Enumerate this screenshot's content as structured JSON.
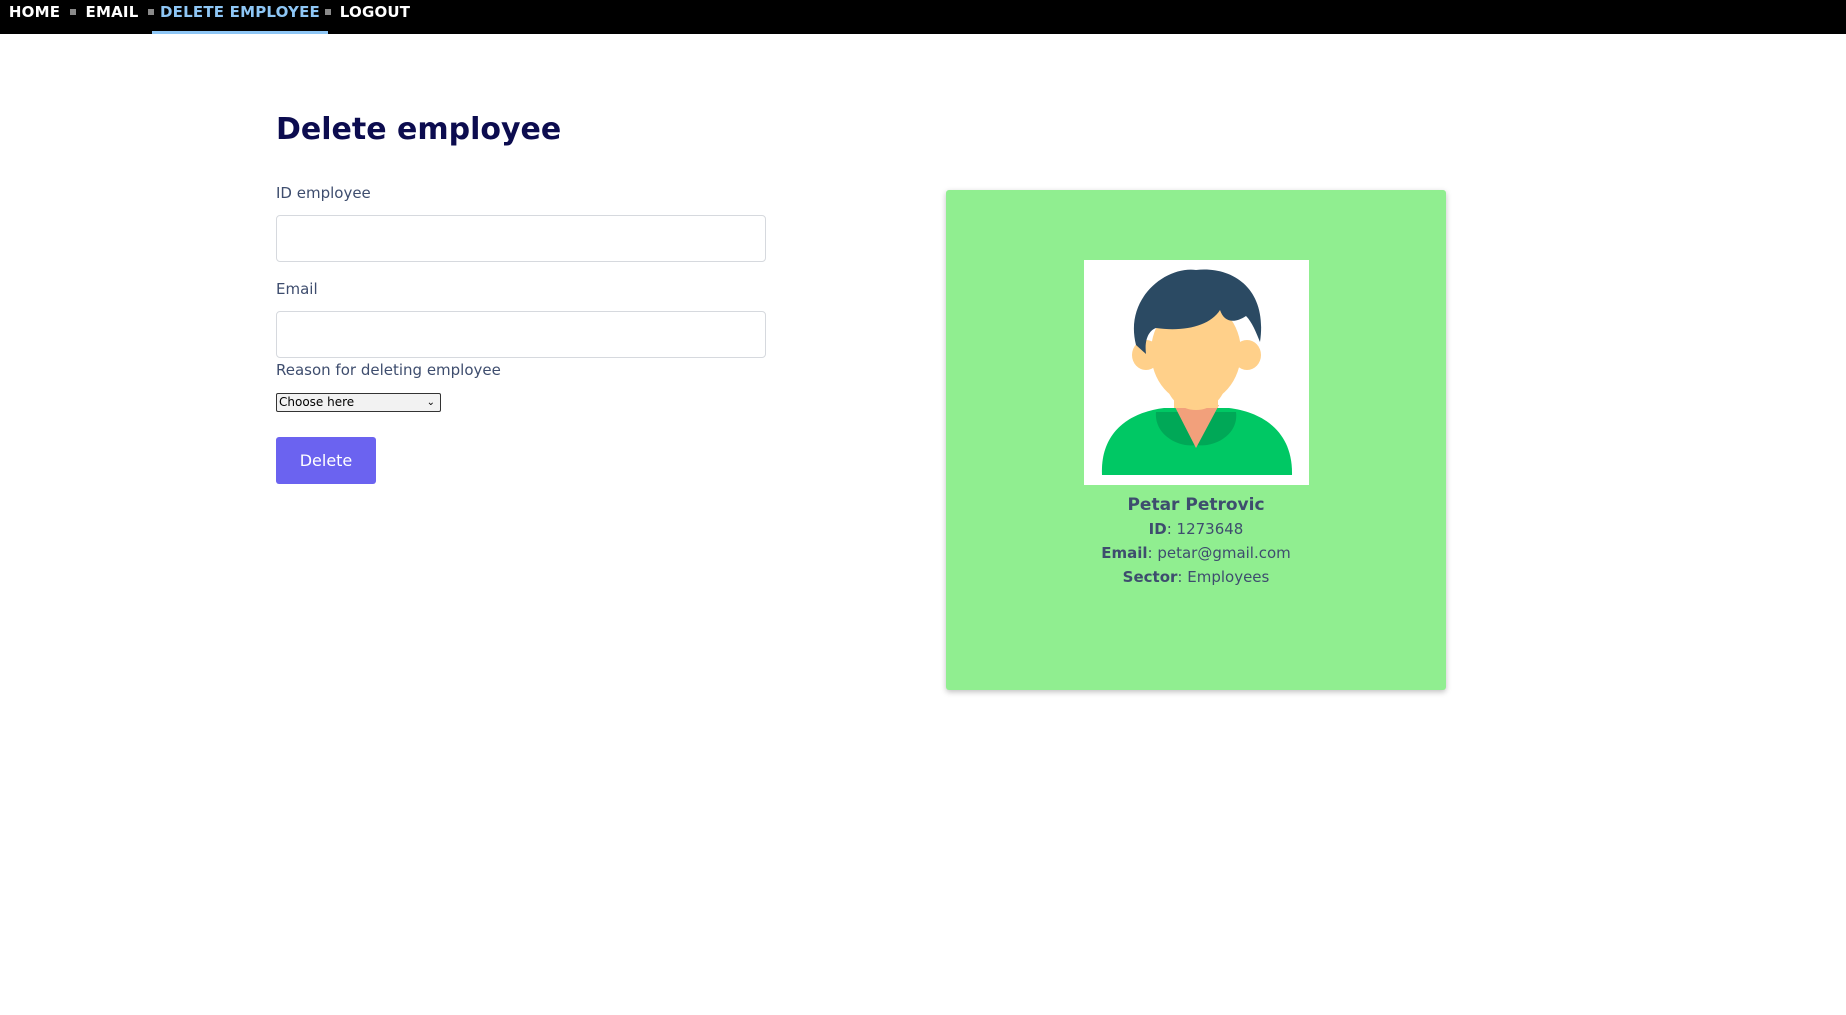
{
  "nav": {
    "items": [
      {
        "label": "HOME"
      },
      {
        "label": "EMAIL"
      },
      {
        "label": "DELETE EMPLOYEE"
      },
      {
        "label": "LOGOUT"
      }
    ],
    "active_index": 2,
    "active_color": "#8ec6f5"
  },
  "form": {
    "title": "Delete employee",
    "id_label": "ID employee",
    "id_value": "",
    "email_label": "Email",
    "email_value": "",
    "reason_label": "Reason for deleting employee",
    "reason_selected": "Choose here",
    "submit_label": "Delete",
    "button_color": "#6b63f0"
  },
  "card": {
    "background": "#90ee90",
    "avatar_icon": "user-avatar-icon",
    "name": "Petar Petrovic",
    "id_label": "ID",
    "id_value": "1273648",
    "email_label": "Email",
    "email_value": "petar@gmail.com",
    "sector_label": "Sector",
    "sector_value": "Employees"
  }
}
